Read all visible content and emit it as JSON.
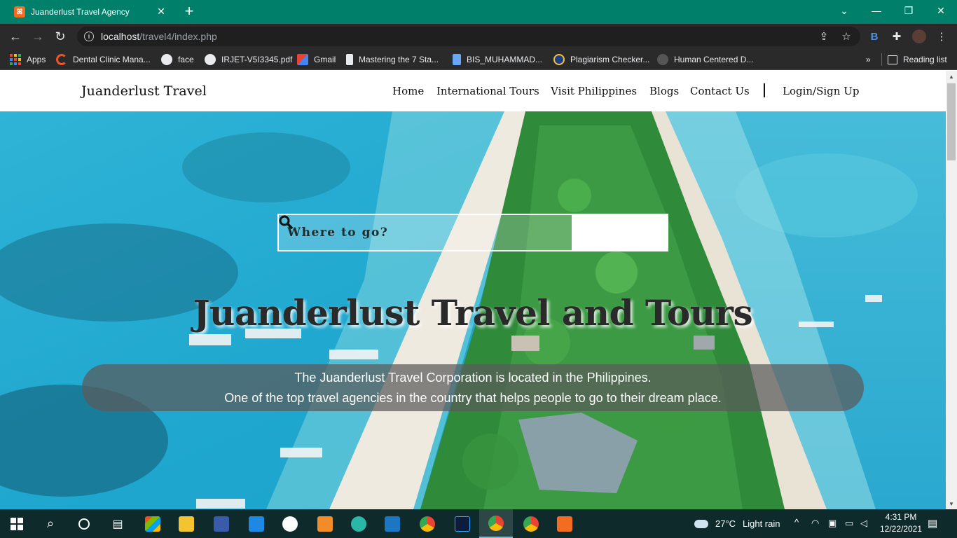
{
  "browser": {
    "tab_title": "Juanderlust Travel Agency",
    "tab_favicon": "xampp-icon",
    "url_host": "localhost",
    "url_path": "/travel4/index.php",
    "theme_color": "#00806a",
    "bookmarks": [
      {
        "label": "Apps",
        "icon": "apps-grid-icon"
      },
      {
        "label": "Dental Clinic Mana...",
        "icon": "clinic-icon"
      },
      {
        "label": "face",
        "icon": "globe-icon"
      },
      {
        "label": "IRJET-V5I3345.pdf",
        "icon": "globe-icon"
      },
      {
        "label": "Gmail",
        "icon": "gmail-icon"
      },
      {
        "label": "Mastering the 7 Sta...",
        "icon": "bookmark-icon"
      },
      {
        "label": "BIS_MUHAMMAD...",
        "icon": "document-icon"
      },
      {
        "label": "Plagiarism Checker...",
        "icon": "plagiarism-icon"
      },
      {
        "label": "Human Centered D...",
        "icon": "design-icon"
      }
    ],
    "more_bookmarks": "»",
    "reading_list": "Reading list"
  },
  "site": {
    "brand": "Juanderlust Travel",
    "nav": [
      "Home",
      "International Tours",
      "Visit Philippines",
      "Blogs",
      "Contact Us"
    ],
    "login": "Login/Sign Up",
    "search_placeholder": "Where to go?",
    "hero_title": "Juanderlust Travel and Tours",
    "caption_line1": "The Juanderlust Travel Corporation is located in the Philippines.",
    "caption_line2": "One of the top travel agencies in the country that helps people to go to their dream place."
  },
  "taskbar": {
    "weather_temp": "27°C",
    "weather_desc": "Light rain",
    "time": "4:31 PM",
    "date": "12/22/2021",
    "apps": [
      "start-icon",
      "search-icon",
      "cortana-icon",
      "task-view-icon",
      "store-icon",
      "file-explorer-icon",
      "visio-icon",
      "mail-icon",
      "notepad-icon",
      "sublime-icon",
      "edge-icon",
      "virtualbox-icon",
      "chrome-icon",
      "photoshop-icon",
      "chrome-profile-icon",
      "chrome-profile-icon",
      "xampp-icon"
    ]
  }
}
